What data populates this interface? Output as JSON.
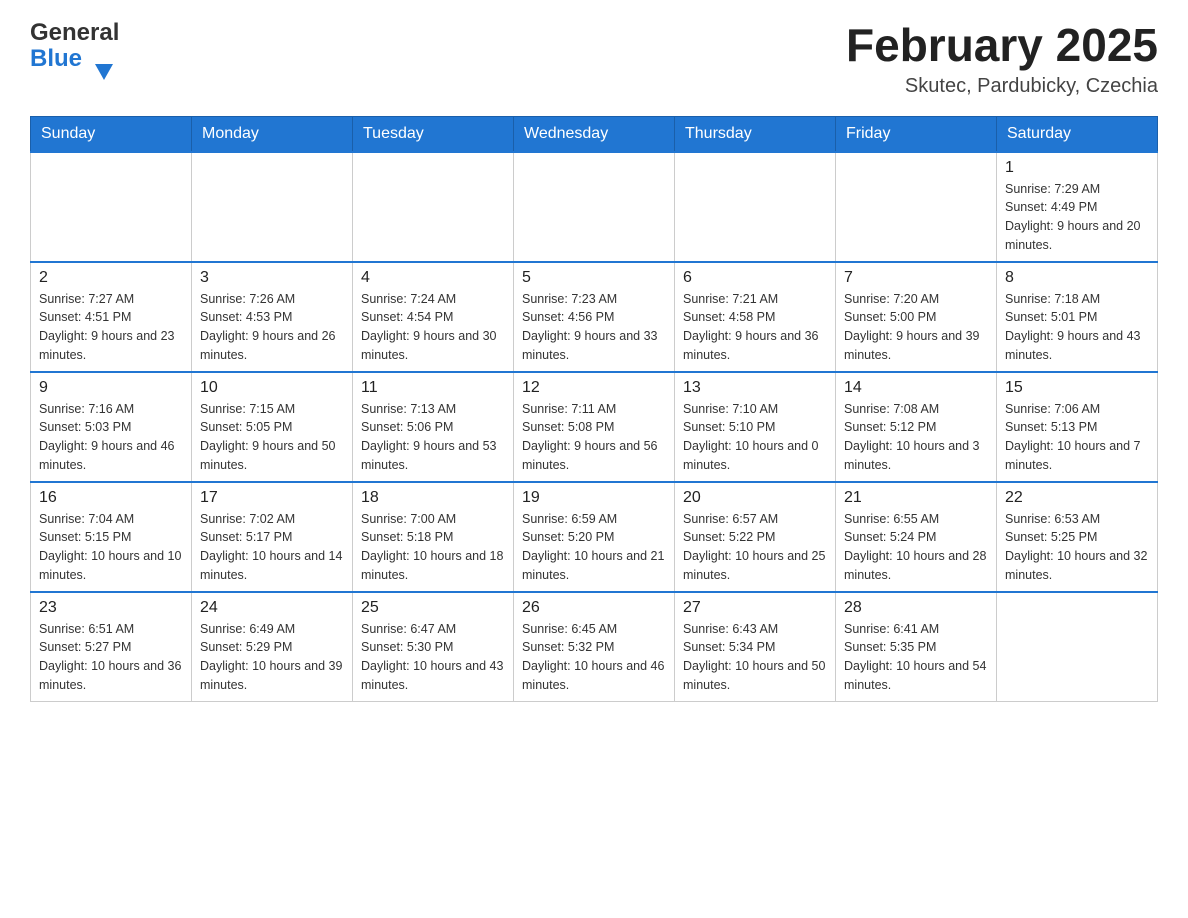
{
  "header": {
    "logo_general": "General",
    "logo_blue": "Blue",
    "month_title": "February 2025",
    "location": "Skutec, Pardubicky, Czechia"
  },
  "days_of_week": [
    "Sunday",
    "Monday",
    "Tuesday",
    "Wednesday",
    "Thursday",
    "Friday",
    "Saturday"
  ],
  "weeks": [
    [
      {
        "day": "",
        "info": ""
      },
      {
        "day": "",
        "info": ""
      },
      {
        "day": "",
        "info": ""
      },
      {
        "day": "",
        "info": ""
      },
      {
        "day": "",
        "info": ""
      },
      {
        "day": "",
        "info": ""
      },
      {
        "day": "1",
        "info": "Sunrise: 7:29 AM\nSunset: 4:49 PM\nDaylight: 9 hours and 20 minutes."
      }
    ],
    [
      {
        "day": "2",
        "info": "Sunrise: 7:27 AM\nSunset: 4:51 PM\nDaylight: 9 hours and 23 minutes."
      },
      {
        "day": "3",
        "info": "Sunrise: 7:26 AM\nSunset: 4:53 PM\nDaylight: 9 hours and 26 minutes."
      },
      {
        "day": "4",
        "info": "Sunrise: 7:24 AM\nSunset: 4:54 PM\nDaylight: 9 hours and 30 minutes."
      },
      {
        "day": "5",
        "info": "Sunrise: 7:23 AM\nSunset: 4:56 PM\nDaylight: 9 hours and 33 minutes."
      },
      {
        "day": "6",
        "info": "Sunrise: 7:21 AM\nSunset: 4:58 PM\nDaylight: 9 hours and 36 minutes."
      },
      {
        "day": "7",
        "info": "Sunrise: 7:20 AM\nSunset: 5:00 PM\nDaylight: 9 hours and 39 minutes."
      },
      {
        "day": "8",
        "info": "Sunrise: 7:18 AM\nSunset: 5:01 PM\nDaylight: 9 hours and 43 minutes."
      }
    ],
    [
      {
        "day": "9",
        "info": "Sunrise: 7:16 AM\nSunset: 5:03 PM\nDaylight: 9 hours and 46 minutes."
      },
      {
        "day": "10",
        "info": "Sunrise: 7:15 AM\nSunset: 5:05 PM\nDaylight: 9 hours and 50 minutes."
      },
      {
        "day": "11",
        "info": "Sunrise: 7:13 AM\nSunset: 5:06 PM\nDaylight: 9 hours and 53 minutes."
      },
      {
        "day": "12",
        "info": "Sunrise: 7:11 AM\nSunset: 5:08 PM\nDaylight: 9 hours and 56 minutes."
      },
      {
        "day": "13",
        "info": "Sunrise: 7:10 AM\nSunset: 5:10 PM\nDaylight: 10 hours and 0 minutes."
      },
      {
        "day": "14",
        "info": "Sunrise: 7:08 AM\nSunset: 5:12 PM\nDaylight: 10 hours and 3 minutes."
      },
      {
        "day": "15",
        "info": "Sunrise: 7:06 AM\nSunset: 5:13 PM\nDaylight: 10 hours and 7 minutes."
      }
    ],
    [
      {
        "day": "16",
        "info": "Sunrise: 7:04 AM\nSunset: 5:15 PM\nDaylight: 10 hours and 10 minutes."
      },
      {
        "day": "17",
        "info": "Sunrise: 7:02 AM\nSunset: 5:17 PM\nDaylight: 10 hours and 14 minutes."
      },
      {
        "day": "18",
        "info": "Sunrise: 7:00 AM\nSunset: 5:18 PM\nDaylight: 10 hours and 18 minutes."
      },
      {
        "day": "19",
        "info": "Sunrise: 6:59 AM\nSunset: 5:20 PM\nDaylight: 10 hours and 21 minutes."
      },
      {
        "day": "20",
        "info": "Sunrise: 6:57 AM\nSunset: 5:22 PM\nDaylight: 10 hours and 25 minutes."
      },
      {
        "day": "21",
        "info": "Sunrise: 6:55 AM\nSunset: 5:24 PM\nDaylight: 10 hours and 28 minutes."
      },
      {
        "day": "22",
        "info": "Sunrise: 6:53 AM\nSunset: 5:25 PM\nDaylight: 10 hours and 32 minutes."
      }
    ],
    [
      {
        "day": "23",
        "info": "Sunrise: 6:51 AM\nSunset: 5:27 PM\nDaylight: 10 hours and 36 minutes."
      },
      {
        "day": "24",
        "info": "Sunrise: 6:49 AM\nSunset: 5:29 PM\nDaylight: 10 hours and 39 minutes."
      },
      {
        "day": "25",
        "info": "Sunrise: 6:47 AM\nSunset: 5:30 PM\nDaylight: 10 hours and 43 minutes."
      },
      {
        "day": "26",
        "info": "Sunrise: 6:45 AM\nSunset: 5:32 PM\nDaylight: 10 hours and 46 minutes."
      },
      {
        "day": "27",
        "info": "Sunrise: 6:43 AM\nSunset: 5:34 PM\nDaylight: 10 hours and 50 minutes."
      },
      {
        "day": "28",
        "info": "Sunrise: 6:41 AM\nSunset: 5:35 PM\nDaylight: 10 hours and 54 minutes."
      },
      {
        "day": "",
        "info": ""
      }
    ]
  ]
}
